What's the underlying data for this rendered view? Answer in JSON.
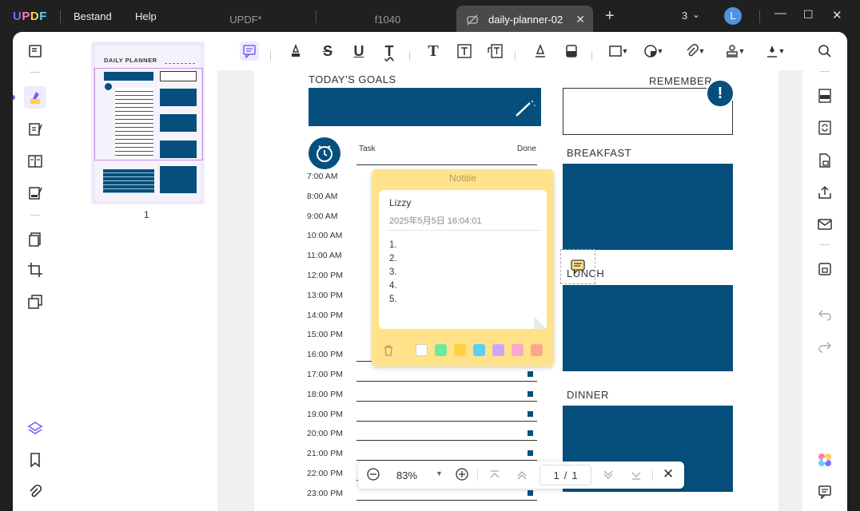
{
  "titlebar": {
    "logo": {
      "u": "U",
      "p": "P",
      "d": "D",
      "f": "F"
    },
    "menus": [
      "Bestand",
      "Help"
    ],
    "tabs": [
      "UPDF*",
      "f1040",
      "daily-planner-02"
    ],
    "tab_count": "3",
    "avatar": "L"
  },
  "thumbnail": {
    "page_number": "1",
    "title": "DAILY PLANNER"
  },
  "page": {
    "goals_title": "TODAY'S GOALS",
    "remember_title": "REMEMBER",
    "remember_mark": "!",
    "task_header": "Task",
    "done_header": "Done",
    "breakfast": "BREAKFAST",
    "lunch": "LUNCH",
    "dinner": "DINNER",
    "times": [
      "7:00 AM",
      "8:00 AM",
      "9:00 AM",
      "10:00 AM",
      "11:00 AM",
      "12:00 PM",
      "13:00 PM",
      "14:00 PM",
      "15:00 PM",
      "16:00 PM",
      "17:00 PM",
      "18:00 PM",
      "19:00 PM",
      "20:00 PM",
      "21:00 PM",
      "22:00 PM",
      "23:00 PM"
    ]
  },
  "note": {
    "header": "Notitie",
    "author": "Lizzy",
    "timestamp": "2025年5月5日 16:04:01",
    "items": [
      "1.",
      "2.",
      "3.",
      "4.",
      "5."
    ],
    "swatches": [
      "#ffffff",
      "#6ee7a0",
      "#ffd23f",
      "#5ccff5",
      "#cba6f7",
      "#f9a8c8",
      "#f8a98b"
    ]
  },
  "zoom": {
    "value": "83%",
    "current_page": "1",
    "separator": "/",
    "total_pages": "1"
  },
  "colors": {
    "accent": "#7c5cff",
    "planner_blue": "#064f7c",
    "note_yellow": "#ffe28a"
  }
}
